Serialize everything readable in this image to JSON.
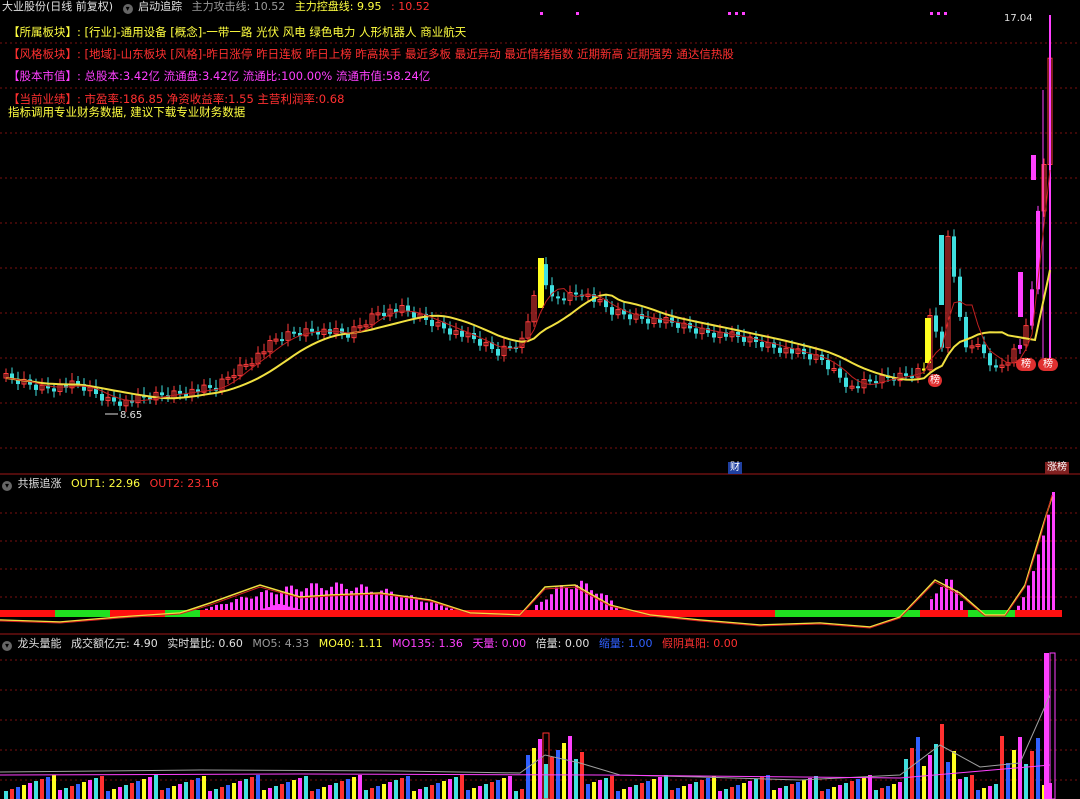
{
  "main_header": {
    "title": "大业股份(日线 前复权)",
    "indicator_name": "启动追踪",
    "l1": "主力攻击线: 10.52",
    "l2": "主力控盘线: 9.95",
    "l3": ": 10.52"
  },
  "info_lines": {
    "sector_label": "【所属板块】:",
    "sector_text": "[行业]-通用设备 [概念]-一带一路 光伏 风电 绿色电力 人形机器人 商业航天",
    "style_label": "【风格板块】:",
    "style_text": "[地域]-山东板块 [风格]-昨日涨停 昨日连板 昨日上榜 昨高换手 最近多板 最近异动 最近情绪指数 近期新高 近期强势 通达信热股",
    "capital_label": "【股本市值】:",
    "capital_text": "总股本:3.42亿 流通盘:3.42亿 流通比:100.00% 流通市值:58.24亿",
    "perf_label": "【当前业绩】:",
    "perf_text": "市盈率:186.85 净资收益率:1.55 主营利润率:0.68",
    "note_text": "指标调用专业财务数据, 建议下载专业财务数据"
  },
  "price_labels": {
    "high": "17.04",
    "low": "8.65",
    "bang1": "榜",
    "bang2": "榜",
    "bang3": "榜",
    "cai": "财",
    "zhangbang": "涨榜"
  },
  "panel2": {
    "name": "共振追涨",
    "out1": "OUT1: 22.96",
    "out2": "OUT2: 23.16"
  },
  "panel3": {
    "name": "龙头量能",
    "amount": "成交额亿元: 4.90",
    "ratio": "实时量比: 0.60",
    "mo5": "MO5: 4.33",
    "mo40": "MO40: 1.11",
    "mo135": "MO135: 1.36",
    "tianliang": "天量: 0.00",
    "beiliang": "倍量: 0.00",
    "suoliang": "缩量: 1.00",
    "fushu": "假阴真阳: 0.00"
  },
  "colors": {
    "up": "#ff3c3c",
    "down": "#40e0e0",
    "ma": "#f0e040",
    "magenta": "#ff40ff",
    "yellow_bar": "#ffff20"
  }
}
